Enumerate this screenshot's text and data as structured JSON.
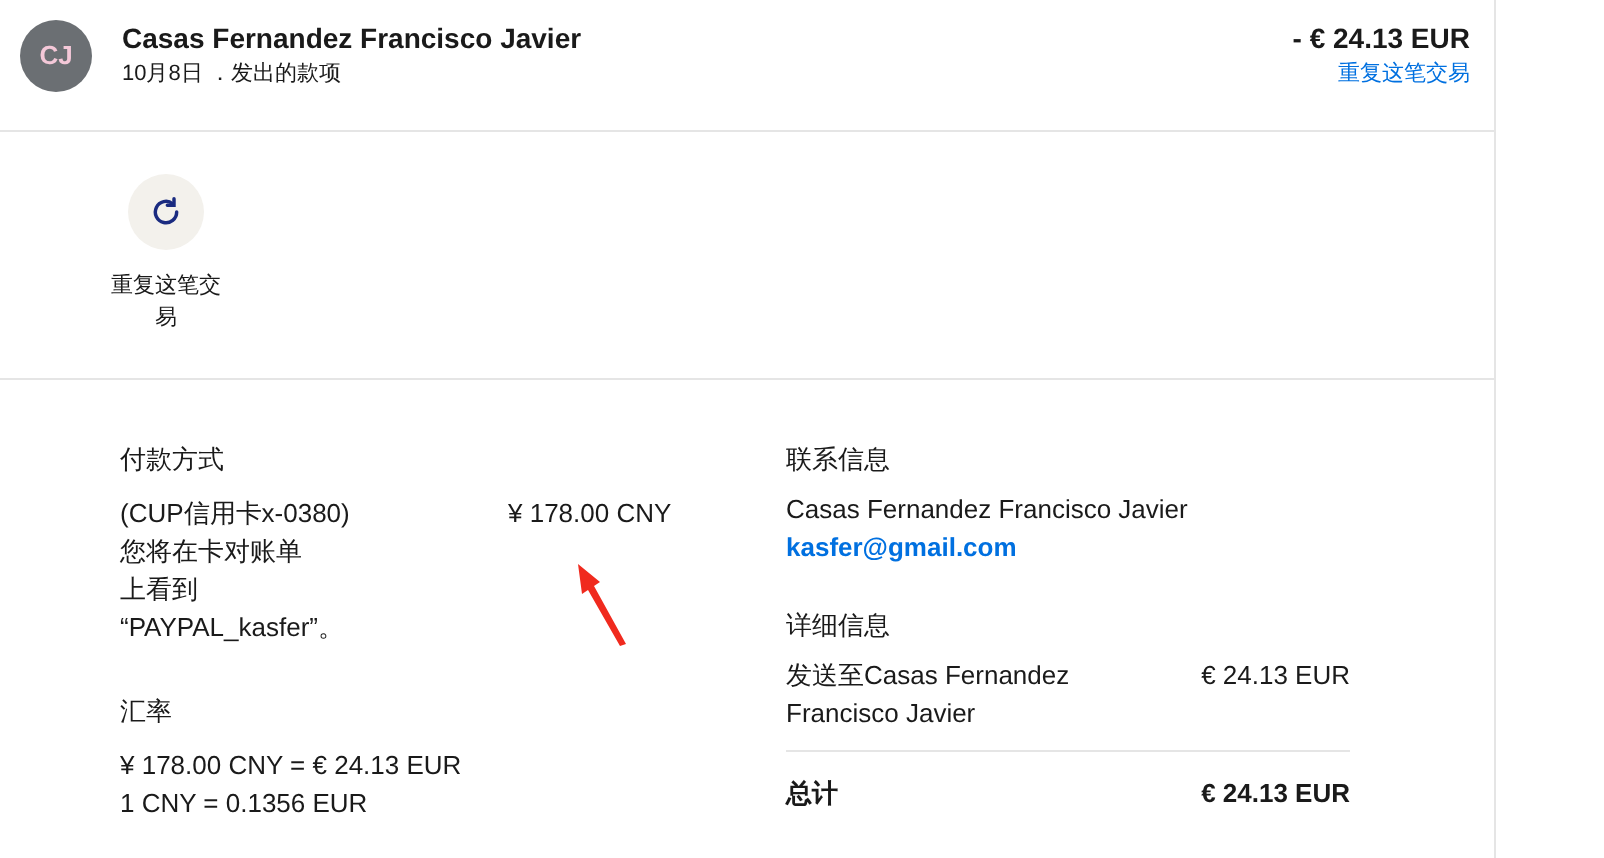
{
  "header": {
    "avatar_initials": "CJ",
    "name": "Casas Fernandez Francisco Javier",
    "subtitle": "10月8日 ．发出的款项",
    "amount": "- € 24.13 EUR",
    "repeat_link": "重复这笔交易"
  },
  "actions": [
    {
      "label": "重复这笔交易"
    }
  ],
  "payment": {
    "heading": "付款方式",
    "method": "(CUP信用卡x-0380)",
    "note": "您将在卡对账单上看到“PAYPAL_kasfer”。",
    "amount": "¥ 178.00 CNY"
  },
  "exchange": {
    "heading": "汇率",
    "lines": [
      "¥ 178.00 CNY = € 24.13 EUR",
      "1 CNY = 0.1356 EUR"
    ]
  },
  "contact": {
    "heading": "联系信息",
    "name": "Casas Fernandez Francisco Javier",
    "email": "kasfer@gmail.com"
  },
  "details": {
    "heading": "详细信息",
    "items": [
      {
        "label": "发送至Casas Fernandez Francisco Javier",
        "amount": "€ 24.13 EUR"
      }
    ],
    "total_label": "总计",
    "total_amount": "€ 24.13 EUR"
  }
}
